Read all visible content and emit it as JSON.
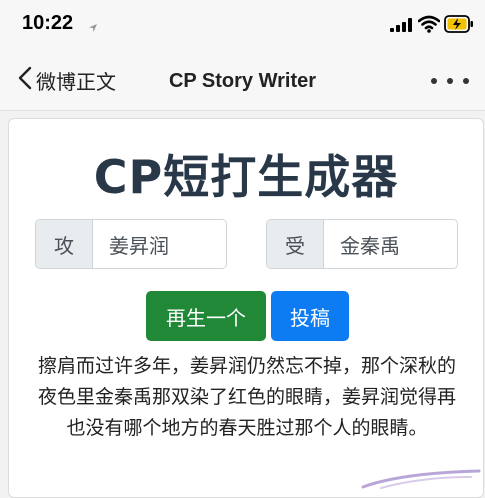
{
  "status": {
    "time": "10:22"
  },
  "nav": {
    "back_label": "微博正文",
    "title": "CP Story Writer"
  },
  "main": {
    "title": "CP短打生成器",
    "top": {
      "label": "攻",
      "value": "姜昇润"
    },
    "bottom": {
      "label": "受",
      "value": "金秦禹"
    },
    "regenerate_label": "再生一个",
    "submit_label": "投稿",
    "story": "擦肩而过许多年，姜昇润仍然忘不掉，那个深秋的夜色里金秦禹那双染了红色的眼睛，姜昇润觉得再也没有哪个地方的春天胜过那个人的眼睛。"
  },
  "colors": {
    "regenerate": "#218838",
    "submit": "#0d7cf2",
    "title": "#283848",
    "battery": "#f2c200"
  }
}
